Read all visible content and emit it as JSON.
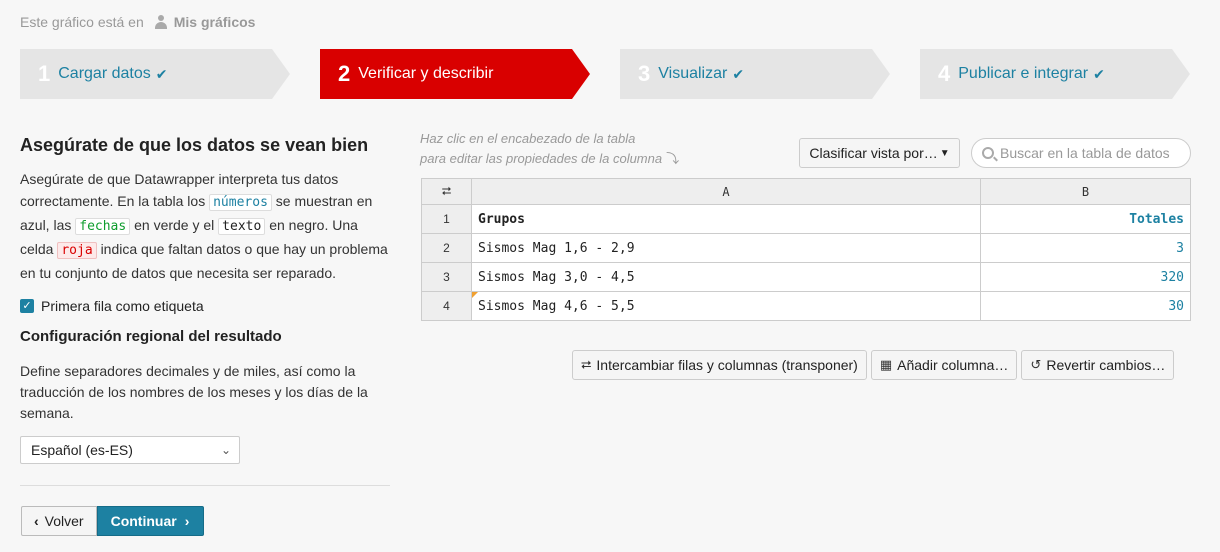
{
  "location": {
    "prefix": "Este gráfico está en",
    "folder": "Mis gráficos"
  },
  "steps": [
    {
      "num": "1",
      "label": "Cargar datos",
      "done": true
    },
    {
      "num": "2",
      "label": "Verificar y describir",
      "active": true
    },
    {
      "num": "3",
      "label": "Visualizar",
      "done": true
    },
    {
      "num": "4",
      "label": "Publicar e integrar",
      "done": true
    }
  ],
  "left": {
    "title": "Asegúrate de que los datos se vean bien",
    "desc": {
      "p1": "Asegúrate de que Datawrapper interpreta tus datos correctamente. En la tabla los",
      "tag_numbers": "números",
      "p2": "se muestran en azul, las",
      "tag_dates": "fechas",
      "p3": "en verde y el",
      "tag_text": "texto",
      "p4": "en negro. Una celda",
      "tag_red": "roja",
      "p5": "indica que faltan datos o que hay un problema en tu conjunto de datos que necesita ser reparado."
    },
    "first_row_label": "Primera fila como etiqueta",
    "locale_title": "Configuración regional del resultado",
    "locale_desc": "Define separadores decimales y de miles, así como la traducción de los nombres de los meses y los días de la semana.",
    "locale_value": "Español (es-ES)",
    "back_label": "Volver",
    "continue_label": "Continuar"
  },
  "right": {
    "hint_line1": "Haz clic en el encabezado de la tabla",
    "hint_line2": "para editar las propiedades de la columna",
    "sort_label": "Clasificar vista por…",
    "search_placeholder": "Buscar en la tabla de datos",
    "columns": [
      "A",
      "B"
    ],
    "rows": [
      {
        "n": "1",
        "a": "Grupos",
        "b": "Totales"
      },
      {
        "n": "2",
        "a": "Sismos Mag 1,6 - 2,9",
        "b": "3"
      },
      {
        "n": "3",
        "a": "Sismos Mag 3,0 - 4,5",
        "b": "320"
      },
      {
        "n": "4",
        "a": "Sismos Mag 4,6 - 5,5",
        "b": "30"
      }
    ],
    "transpose_label": "Intercambiar filas y columnas (transponer)",
    "add_column_label": "Añadir columna…",
    "revert_label": "Revertir cambios…"
  },
  "colors": {
    "accent": "#1d81a2",
    "active_step": "#d90000"
  }
}
